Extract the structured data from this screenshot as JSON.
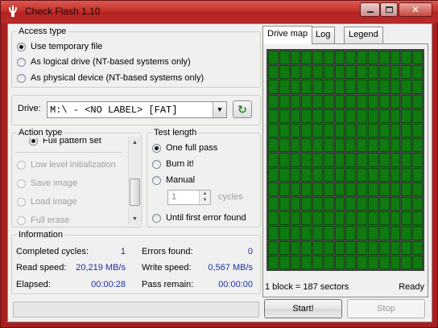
{
  "window": {
    "title": "Check Flash 1.10",
    "minimize_icon": "minimize-icon",
    "maximize_icon": "maximize-icon",
    "close_icon": "close-icon",
    "accent": "#b52424"
  },
  "access_type": {
    "legend": "Access type",
    "options": [
      {
        "label": "Use temporary file",
        "selected": true
      },
      {
        "label": "As logical drive (NT-based systems only)",
        "selected": false
      },
      {
        "label": "As physical device (NT-based systems only)",
        "selected": false
      }
    ]
  },
  "drive": {
    "label": "Drive:",
    "value": "M:\\ - <NO LABEL> [FAT]",
    "refresh_icon": "refresh-icon"
  },
  "action_type": {
    "legend": "Action type",
    "options": [
      {
        "label": "Full pattern set",
        "enabled": true
      },
      {
        "label": "Low level initialization",
        "enabled": false
      },
      {
        "label": "Save image",
        "enabled": false
      },
      {
        "label": "Load image",
        "enabled": false
      },
      {
        "label": "Full erase",
        "enabled": false
      }
    ]
  },
  "test_length": {
    "legend": "Test length",
    "options": [
      {
        "label": "One full pass",
        "selected": true
      },
      {
        "label": "Burn it!",
        "selected": false
      },
      {
        "label": "Manual",
        "selected": false
      },
      {
        "label": "Until first error found",
        "selected": false
      }
    ],
    "cycles_value": "1",
    "cycles_label": "cycles"
  },
  "information": {
    "legend": "Information",
    "completed_cycles_label": "Completed cycles:",
    "completed_cycles_value": "1",
    "errors_found_label": "Errors found:",
    "errors_found_value": "0",
    "read_speed_label": "Read speed:",
    "read_speed_value": "20,219 MB/s",
    "write_speed_label": "Write speed:",
    "write_speed_value": "0,567 MB/s",
    "elapsed_label": "Elapsed:",
    "elapsed_value": "00:00:28",
    "pass_remain_label": "Pass remain:",
    "pass_remain_value": "00:00:00"
  },
  "tabs": [
    {
      "label": "Drive map",
      "active": true
    },
    {
      "label": "Log",
      "active": false
    },
    {
      "label": "Legend",
      "active": false
    }
  ],
  "drive_map": {
    "block_color": "#0f7a0f",
    "block_info": "1 block = 187 sectors",
    "status": "Ready"
  },
  "buttons": {
    "start": "Start!",
    "stop": "Stop"
  },
  "progress": {
    "value": 0
  }
}
